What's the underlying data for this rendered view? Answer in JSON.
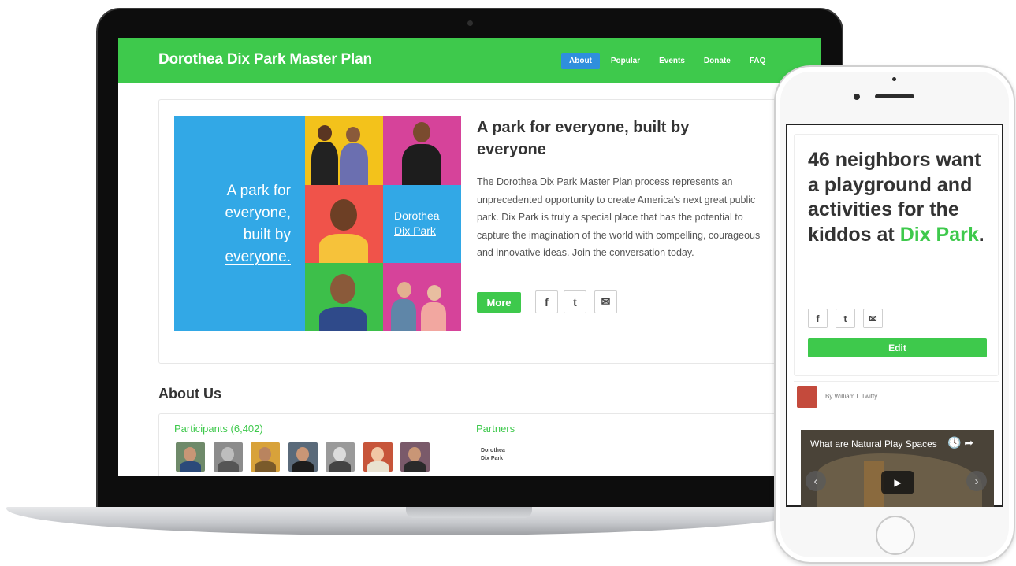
{
  "site": {
    "title": "Dorothea Dix Park Master Plan",
    "nav": [
      "About",
      "Popular",
      "Events",
      "Donate",
      "FAQ"
    ],
    "active_nav": "About",
    "accent_color": "#3ec94c",
    "active_nav_color": "#2f8fdd"
  },
  "hero": {
    "tagline_line1": "A park for",
    "tagline_line2": "everyone,",
    "tagline_line3": "built by",
    "tagline_line4": "everyone.",
    "logo_line1": "Dorothea",
    "logo_line2": "Dix Park",
    "heading": "A park for everyone, built by everyone",
    "description": "The Dorothea Dix Park Master Plan process represents an unprecedented opportunity to create America's next great public park. Dix Park is truly a special place that has the potential to capture the imagination of the world with compelling, courageous and innovative ideas. Join the conversation today.",
    "more_label": "More",
    "share_icons": [
      "facebook-icon",
      "twitter-icon",
      "mail-icon"
    ],
    "share_glyphs": [
      "f",
      "t",
      "✉"
    ]
  },
  "about": {
    "title": "About Us",
    "participants_label": "Participants (6,402)",
    "partners_label": "Partners",
    "partner_logo_line1": "Dorothea",
    "partner_logo_line2": "Dix Park"
  },
  "mobile": {
    "heading_main": "46 neighbors want a playground and activities for the kiddos at ",
    "heading_highlight": "Dix Park",
    "heading_end": ".",
    "share_glyphs": [
      "f",
      "t",
      "✉"
    ],
    "edit_label": "Edit",
    "author": "By William L Twitty",
    "video_title": "What are Natural Play Spaces",
    "video_icons": "🕓 ➦",
    "play_glyph": "▶",
    "prev_glyph": "‹",
    "next_glyph": "›"
  }
}
